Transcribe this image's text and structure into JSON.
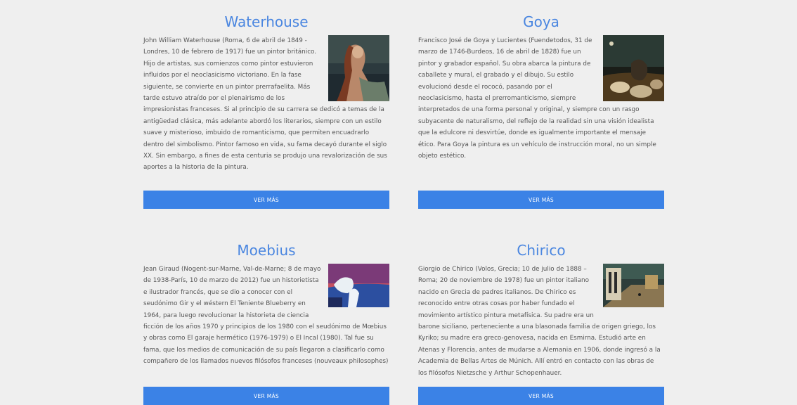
{
  "artists": [
    {
      "name": "Waterhouse",
      "bio": "John William Waterhouse (Roma, 6 de abril de 1849 - Londres, 10 de febrero de 1917) fue un pintor británico. Hijo de artistas, sus comienzos como pintor estuvieron influidos por el neoclasicismo victoriano. En la fase siguiente, se convierte en un pintor prerrafaelita. Más tarde estuvo atraído por el plenairismo de los impresionistas franceses. Si al principio de su carrera se dedicó a temas de la antigüedad clásica, más adelante abordó los literarios, siempre con un estilo suave y misterioso, imbuido de romanticismo, que permiten encuadrarlo dentro del simbolismo. Pintor famoso en vida, su fama decayó durante el siglo XX. Sin embargo, a fines de esta centuria se produjo una revalorización de sus aportes a la historia de la pintura.",
      "button": "VER MÁS"
    },
    {
      "name": "Goya",
      "bio": "Francisco José de Goya y Lucientes (Fuendetodos, 31 de marzo de 1746-Burdeos, 16 de abril de 1828) fue un pintor y grabador español. Su obra abarca la pintura de caballete y mural, el grabado y el dibujo. Su estilo evolucionó desde el rococó, pasando por el neoclasicismo, hasta el prerromanticismo, siempre interpretados de una forma personal y original, y siempre con un rasgo subyacente de naturalismo, del reflejo de la realidad sin una visión idealista que la edulcore ni desvirtúe, donde es igualmente importante el mensaje ético. Para Goya la pintura es un vehículo de instrucción moral, no un simple objeto estético.",
      "button": "VER MÁS"
    },
    {
      "name": "Moebius",
      "bio": "Jean Giraud (Nogent-sur-Marne, Val-de-Marne; 8 de mayo de 1938-París, 10 de marzo de 2012) fue un historietista e ilustrador francés, que se dio a conocer con el seudónimo Gir y el wéstern El Teniente Blueberry en 1964, para luego revolucionar la historieta de ciencia ficción de los años 1970 y principios de los 1980 con el seudónimo de Mœbius y obras como El garaje hermético (1976-1979) o El Incal (1980). Tal fue su fama, que los medios de comunicación de su país llegaron a clasificarlo como compañero de los llamados nuevos filósofos franceses (nouveaux philosophes)",
      "button": "VER MÁS"
    },
    {
      "name": "Chirico",
      "bio": "Giorgio de Chirico (Volos, Grecia; 10 de julio de 1888 – Roma; 20 de noviembre de 1978) fue un pintor italiano nacido en Grecia de padres italianos. De Chirico es reconocido entre otras cosas por haber fundado el movimiento artístico pintura metafísica. Su padre era un barone siciliano, perteneciente a una blasonada familia de origen griego, los Kyriko; su madre era greco-genovesa, nacida en Esmirna. Estudió arte en Atenas y Florencia, antes de mudarse a Alemania en 1906, donde ingresó a la Academia de Bellas Artes de Múnich. Allí entró en contacto con las obras de los filósofos Nietzsche y Arthur Schopenhauer.",
      "button": "VER MÁS"
    }
  ]
}
